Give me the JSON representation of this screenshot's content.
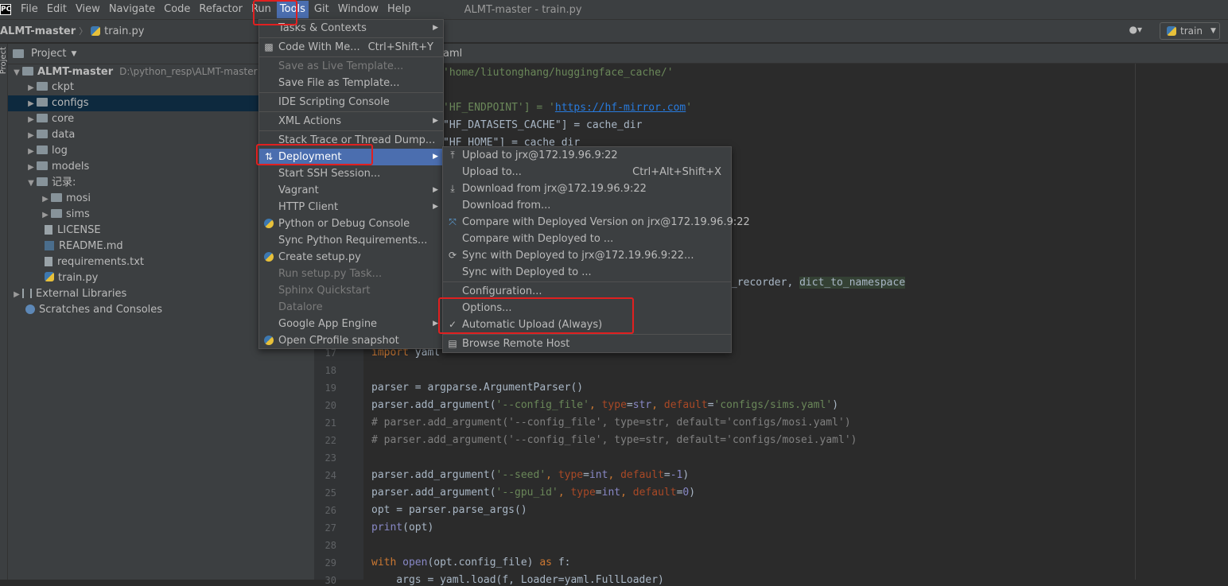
{
  "menubar": {
    "logo": "PC",
    "items": [
      "File",
      "Edit",
      "View",
      "Navigate",
      "Code",
      "Refactor",
      "Run",
      "Tools",
      "Git",
      "Window",
      "Help"
    ],
    "window_title": "ALMT-master - train.py"
  },
  "navbar": {
    "project": "ALMT-master",
    "file": "train.py",
    "run_config": "train"
  },
  "left_strip": {
    "label": "Project"
  },
  "project_panel": {
    "title": "Project",
    "tree": [
      {
        "label": "ALMT-master",
        "path": "D:\\python_resp\\ALMT-master"
      },
      {
        "label": "ckpt"
      },
      {
        "label": "configs"
      },
      {
        "label": "core"
      },
      {
        "label": "data"
      },
      {
        "label": "log"
      },
      {
        "label": "models"
      },
      {
        "label": "记录:"
      },
      {
        "label": "mosi"
      },
      {
        "label": "sims"
      },
      {
        "label": "LICENSE"
      },
      {
        "label": "README.md"
      },
      {
        "label": "requirements.txt"
      },
      {
        "label": "train.py"
      },
      {
        "label": "External Libraries"
      },
      {
        "label": "Scratches and Consoles"
      }
    ]
  },
  "editor": {
    "tab_fragment": "aml",
    "lines_top": {
      "l1": "'home/liutonghang/huggingface_cache/'",
      "l3a": "'HF_ENDPOINT'] = '",
      "l3url": "https://hf-mirror.com",
      "l3b": "'",
      "l4": "\"HF_DATASETS_CACHE\"] = cache_dir",
      "l5": "\"HF_HOME\"] = cache_dir",
      "l_import_a": "_recorder, ",
      "l_import_b": "dict_to_namespace"
    },
    "line_numbers": [
      "17",
      "18",
      "19",
      "20",
      "21",
      "22",
      "23",
      "24",
      "25",
      "26",
      "27",
      "28",
      "29",
      "30"
    ],
    "code": {
      "c17a": "import",
      "c17b": " yaml",
      "c19": "parser = argparse.ArgumentParser()",
      "c20a": "parser.add_argument(",
      "c20b": "'--config_file'",
      "c20c": ", ",
      "c20d": "type",
      "c20e": "=",
      "c20f": "str",
      "c20g": ", ",
      "c20h": "default",
      "c20i": "=",
      "c20j": "'configs/sims.yaml'",
      "c20k": ")",
      "c21": "# parser.add_argument('--config_file', type=str, default='configs/mosi.yaml')",
      "c22": "# parser.add_argument('--config_file', type=str, default='configs/mosei.yaml')",
      "c24a": "parser.add_argument(",
      "c24b": "'--seed'",
      "c24c": ", ",
      "c24d": "type",
      "c24e": "=",
      "c24f": "int",
      "c24g": ", ",
      "c24h": "default",
      "c24i": "=",
      "c24j": "-1",
      "c24k": ")",
      "c25a": "parser.add_argument(",
      "c25b": "'--gpu_id'",
      "c25c": ", ",
      "c25d": "type",
      "c25e": "=",
      "c25f": "int",
      "c25g": ", ",
      "c25h": "default",
      "c25i": "=",
      "c25j": "0",
      "c25k": ")",
      "c26": "opt = parser.parse_args()",
      "c27a": "print",
      "c27b": "(opt)",
      "c29a": "with ",
      "c29b": "open",
      "c29c": "(opt.config_file) ",
      "c29d": "as",
      "c29e": " f:",
      "c30": "    args = yaml.load(f, Loader=yaml.FullLoader)"
    }
  },
  "tools_menu": {
    "items": [
      {
        "label": "Tasks & Contexts",
        "submenu": true
      },
      {
        "label": "Code With Me...",
        "shortcut": "Ctrl+Shift+Y"
      },
      {
        "label": "Save as Live Template..."
      },
      {
        "label": "Save File as Template..."
      },
      {
        "label": "IDE Scripting Console"
      },
      {
        "label": "XML Actions",
        "submenu": true
      },
      {
        "label": "Stack Trace or Thread Dump..."
      },
      {
        "label": "Deployment",
        "submenu": true
      },
      {
        "label": "Start SSH Session..."
      },
      {
        "label": "Vagrant",
        "submenu": true
      },
      {
        "label": "HTTP Client",
        "submenu": true
      },
      {
        "label": "Python or Debug Console"
      },
      {
        "label": "Sync Python Requirements..."
      },
      {
        "label": "Create setup.py"
      },
      {
        "label": "Run setup.py Task..."
      },
      {
        "label": "Sphinx Quickstart"
      },
      {
        "label": "Datalore"
      },
      {
        "label": "Google App Engine",
        "submenu": true
      },
      {
        "label": "Open CProfile snapshot"
      }
    ]
  },
  "deployment_menu": {
    "items": [
      {
        "label": "Upload to jrx@172.19.96.9:22"
      },
      {
        "label": "Upload to...",
        "shortcut": "Ctrl+Alt+Shift+X"
      },
      {
        "label": "Download from jrx@172.19.96.9:22"
      },
      {
        "label": "Download from..."
      },
      {
        "label": "Compare with Deployed Version on jrx@172.19.96.9:22"
      },
      {
        "label": "Compare with Deployed to ..."
      },
      {
        "label": "Sync with Deployed to jrx@172.19.96.9:22..."
      },
      {
        "label": "Sync with Deployed to ..."
      },
      {
        "label": "Configuration..."
      },
      {
        "label": "Options..."
      },
      {
        "label": "Automatic Upload (Always)",
        "checked": true
      },
      {
        "label": "Browse Remote Host"
      }
    ]
  },
  "colors": {
    "menu_bg": "#3c3f41",
    "highlight": "#4b6eaf",
    "annotation_red": "#e02020"
  }
}
